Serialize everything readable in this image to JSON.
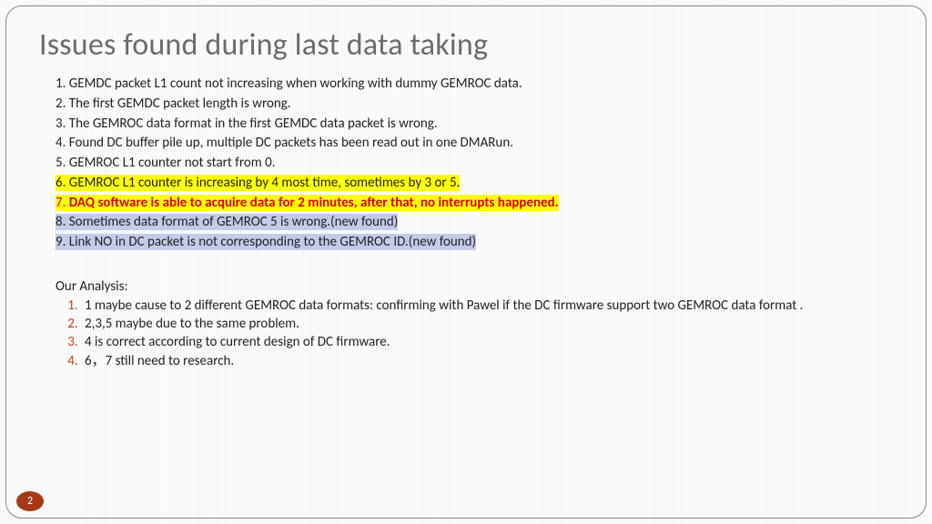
{
  "title": "Issues found during last data taking",
  "issues": [
    {
      "n": "1.",
      "text": "GEMDC packet  L1 count not increasing when working with dummy GEMROC data.",
      "style": "plain"
    },
    {
      "n": "2.",
      "text": "The first GEMDC packet length is wrong.",
      "style": "plain"
    },
    {
      "n": "3.",
      "text": "The GEMROC data format in the first  GEMDC data  packet is wrong.",
      "style": "plain"
    },
    {
      "n": "4.",
      "text": "Found DC buffer pile up, multiple DC packets has been read out  in one DMARun.",
      "style": "plain"
    },
    {
      "n": "5.",
      "text": "GEMROC L1 counter not start from 0.",
      "style": "plain"
    },
    {
      "n": "6.",
      "text": "GEMROC L1 counter is increasing by 4 most time, sometimes by 3 or 5.",
      "style": "yellow"
    },
    {
      "n": "7.",
      "text": "DAQ software is able to acquire data for 2 minutes, after that, no interrupts happened.",
      "style": "yellow-red"
    },
    {
      "n": "8.",
      "text": "Sometimes data format of GEMROC 5 is wrong.(new found)",
      "style": "blue"
    },
    {
      "n": "9.",
      "text": "Link NO in DC packet is not corresponding to the GEMROC ID.(new found)",
      "style": "blue"
    }
  ],
  "analysis_heading": "Our Analysis:",
  "analysis": [
    "1 maybe cause to 2 different GEMROC data formats: confirming with Pawel if the DC firmware support two GEMROC data format .",
    "2,3,5 maybe due to the same problem.",
    "4 is correct according to current design of DC firmware.",
    "6，7 still need to research."
  ],
  "page_number": "2"
}
